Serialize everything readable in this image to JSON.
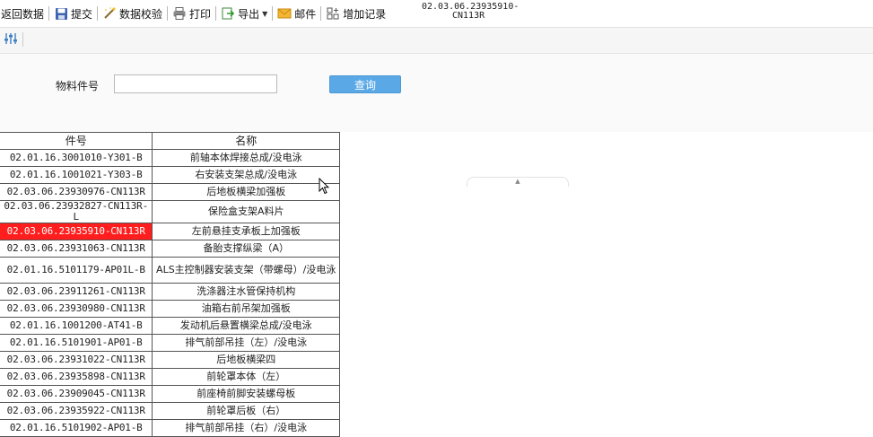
{
  "toolbar": {
    "back_label": "返回数据",
    "submit_label": "提交",
    "validate_label": "数据校验",
    "print_label": "打印",
    "export_label": "导出",
    "mail_label": "邮件",
    "add_label": "增加记录",
    "doc_id_line1": "02.03.06.23935910-",
    "doc_id_line2": "CN113R"
  },
  "filter": {
    "part_no_label": "物料件号",
    "part_no_value": "",
    "query_label": "查询"
  },
  "table": {
    "headers": [
      "件号",
      "名称"
    ],
    "rows": [
      {
        "code": "02.01.16.3001010-Y301-B",
        "name": "前轴本体焊接总成/没电泳"
      },
      {
        "code": "02.01.16.1001021-Y303-B",
        "name": "右安装支架总成/没电泳"
      },
      {
        "code": "02.03.06.23930976-CN113R",
        "name": "后地板横梁加强板"
      },
      {
        "code": "02.03.06.23932827-CN113R-L",
        "name": "保险盒支架A料片"
      },
      {
        "code": "02.03.06.23935910-CN113R",
        "name": "左前悬挂支承板上加强板"
      },
      {
        "code": "02.03.06.23931063-CN113R",
        "name": "备胎支撑纵梁（A）"
      },
      {
        "code": "02.01.16.5101179-AP01L-B",
        "name": "ALS主控制器安装支架（带螺母）/没电泳"
      },
      {
        "code": "02.03.06.23911261-CN113R",
        "name": "洗涤器注水管保持机构"
      },
      {
        "code": "02.03.06.23930980-CN113R",
        "name": "油箱右前吊架加强板"
      },
      {
        "code": "02.01.16.1001200-AT41-B",
        "name": "发动机后悬置横梁总成/没电泳"
      },
      {
        "code": "02.01.16.5101901-AP01-B",
        "name": "排气前部吊挂（左）/没电泳"
      },
      {
        "code": "02.03.06.23931022-CN113R",
        "name": "后地板横梁四"
      },
      {
        "code": "02.03.06.23935898-CN113R",
        "name": "前轮罩本体（左）"
      },
      {
        "code": "02.03.06.23909045-CN113R",
        "name": "前座椅前脚安装螺母板"
      },
      {
        "code": "02.03.06.23935922-CN113R",
        "name": "前轮罩后板（右）"
      },
      {
        "code": "02.01.16.5101902-AP01-B",
        "name": "排气前部吊挂（右）/没电泳"
      }
    ],
    "selected_row_index": 4
  },
  "colors": {
    "selected_cell": "#ff1d1d",
    "query_button": "#5aa9e6"
  },
  "icons": [
    "disk-icon",
    "wand-icon",
    "printer-icon",
    "export-icon",
    "mail-icon",
    "add-record-icon",
    "sliders-icon",
    "cursor-icon"
  ]
}
